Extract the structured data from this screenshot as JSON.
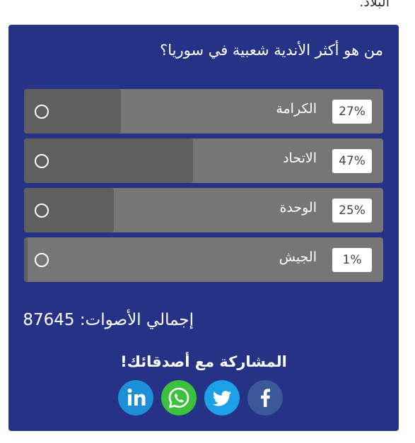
{
  "page": {
    "top_text": "البلاد."
  },
  "poll": {
    "question": "من هو أكثر الأندية شعبية في سوريا؟",
    "options": [
      {
        "label": "الكرامة",
        "percent": "27%",
        "value": 27
      },
      {
        "label": "الاتحاد",
        "percent": "47%",
        "value": 47
      },
      {
        "label": "الوحدة",
        "percent": "25%",
        "value": 25
      },
      {
        "label": "الجيش",
        "percent": "1%",
        "value": 1
      }
    ],
    "total_label": "إجمالي الأصوات:",
    "total_value": "87645"
  },
  "share": {
    "title": "المشاركة مع أصدقائك!",
    "buttons": [
      {
        "network": "linkedin",
        "icon": "linkedin-icon",
        "color": "#1c8fd8"
      },
      {
        "network": "whatsapp",
        "icon": "whatsapp-icon",
        "color": "#3dc03d"
      },
      {
        "network": "twitter",
        "icon": "twitter-icon",
        "color": "#1ca1e8"
      },
      {
        "network": "facebook",
        "icon": "facebook-icon",
        "color": "#3b5998"
      }
    ]
  },
  "colors": {
    "card_background": "#253286",
    "option_track": "#767676",
    "option_fill": "#5f5f5f"
  }
}
